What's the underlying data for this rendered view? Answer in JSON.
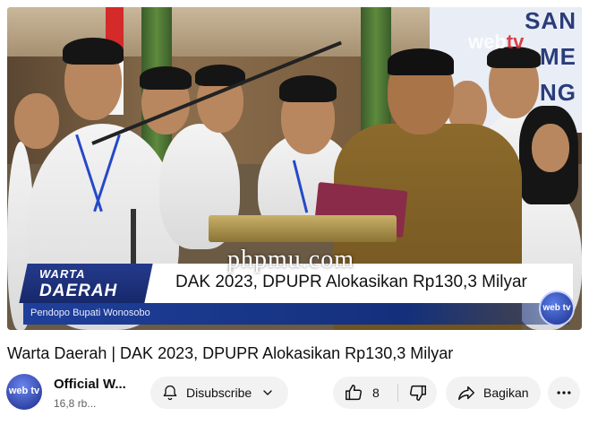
{
  "video": {
    "banner_lines": [
      "SAN",
      "ME",
      "TUNG"
    ],
    "banner_logo": "web tv",
    "watermark_tv": "web",
    "watermark_tv_suffix": "tv",
    "lower_third": {
      "program_line1": "WARTA",
      "program_line2": "DAERAH",
      "headline": "DAK 2023, DPUPR Alokasikan Rp130,3 Milyar",
      "location": "Pendopo Bupati Wonosobo"
    },
    "channel_bug": "web tv",
    "site_watermark": "phpmu.com"
  },
  "title": "Warta Daerah | DAK 2023, DPUPR Alokasikan Rp130,3 Milyar",
  "channel": {
    "name": "Official W...",
    "subscribers": "16,8 rb...",
    "avatar_text": "web tv"
  },
  "actions": {
    "subscribe_label": "Disubscribe",
    "like_count": "8",
    "share_label": "Bagikan"
  },
  "icons": {
    "bell": "bell-icon",
    "chevron": "chevron-down-icon",
    "like": "thumbs-up-icon",
    "dislike": "thumbs-down-icon",
    "share": "share-arrow-icon",
    "more": "more-horizontal-icon"
  },
  "colors": {
    "pill_bg": "#f2f2f2",
    "lower_third_blue": "#17286a",
    "text": "#0f0f0f",
    "secondary_text": "#606060"
  }
}
